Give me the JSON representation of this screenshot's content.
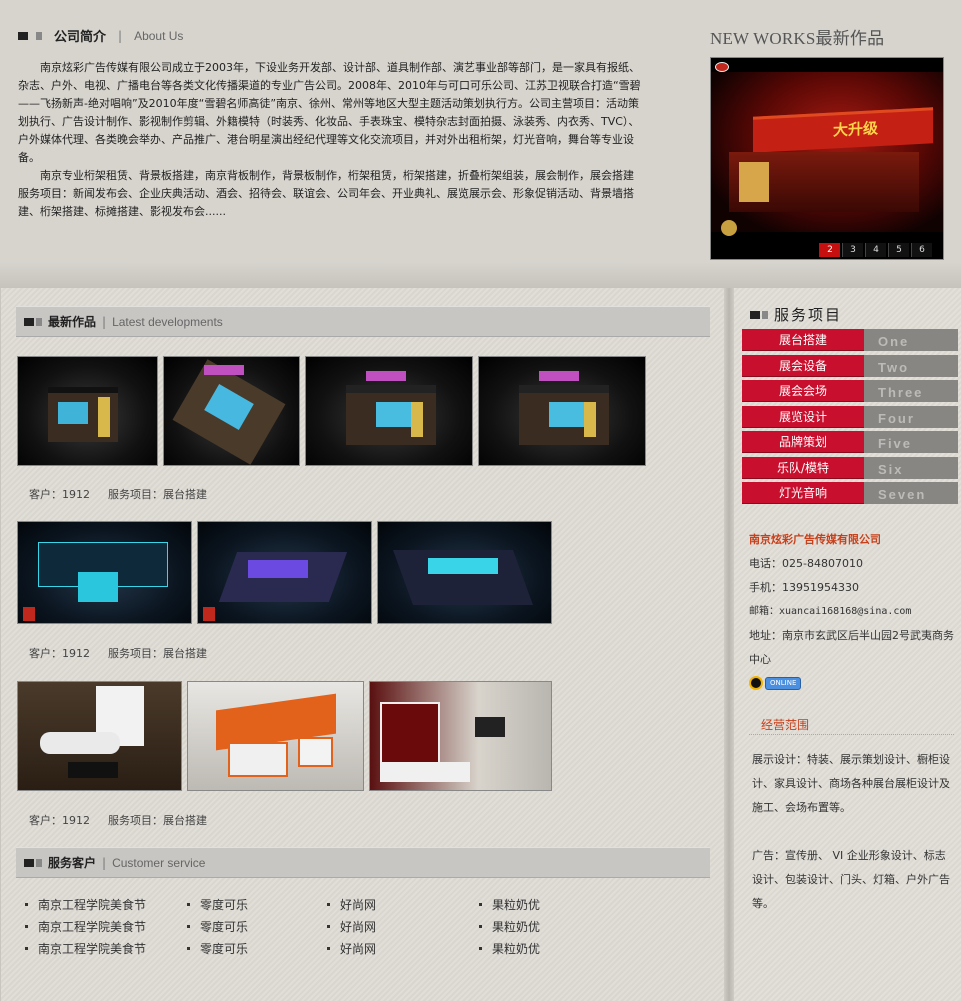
{
  "intro": {
    "title": "公司简介",
    "subtitle": "About Us",
    "paragraphs": [
      "南京炫彩广告传媒有限公司成立于2003年，下设业务开发部、设计部、道具制作部、演艺事业部等部门，是一家具有报纸、杂志、户外、电视、广播电台等各类文化传播渠道的专业广告公司。2008年、2010年与可口可乐公司、江苏卫视联合打造“雪碧——飞扬新声-绝对唱响”及2010年度“雪碧名师高徒”南京、徐州、常州等地区大型主题活动策划执行方。公司主营项目：活动策划执行、广告设计制作、影视制作剪辑、外籍模特（时装秀、化妆品、手表珠宝、模特杂志封面拍摄、泳装秀、内衣秀、TVC）、户外媒体代理、各类晚会举办、产品推广、港台明星演出经纪代理等文化交流项目，并对外出租桁架，灯光音响，舞台等专业设备。",
      "南京专业桁架租赁、背景板搭建，南京背板制作，背景板制作，桁架租赁，桁架搭建，折叠桁架组装，展会制作，展会搭建服务项目：新闻发布会、企业庆典活动、酒会、招待会、联谊会、公司年会、开业典礼、展览展示会、形象促销活动、背景墙搭建、桁架搭建、标摊搭建、影视发布会......"
    ]
  },
  "new_works": {
    "title": "NEW WORKS最新作品",
    "banner_text": "大升级",
    "pager": [
      "2",
      "3",
      "4",
      "5",
      "6"
    ],
    "active_page": "2"
  },
  "latest": {
    "title": "最新作品",
    "subtitle": "Latest developments",
    "groups": [
      {
        "client": "客户：1912",
        "service": "服务项目：展台搭建"
      },
      {
        "client": "客户：1912",
        "service": "服务项目：展台搭建"
      },
      {
        "client": "客户：1912",
        "service": "服务项目：展台搭建"
      }
    ]
  },
  "clients_section": {
    "title": "服务客户",
    "subtitle": "Customer service",
    "rows": [
      [
        "南京工程学院美食节",
        "零度可乐",
        "好尚网",
        "果粒奶优"
      ],
      [
        "南京工程学院美食节",
        "零度可乐",
        "好尚网",
        "果粒奶优"
      ],
      [
        "南京工程学院美食节",
        "零度可乐",
        "好尚网",
        "果粒奶优"
      ]
    ]
  },
  "services": {
    "title": "服务项目",
    "items": [
      {
        "label": "展台搭建",
        "num": "One"
      },
      {
        "label": "展会设备",
        "num": "Two"
      },
      {
        "label": "展会会场",
        "num": "Three"
      },
      {
        "label": "展览设计",
        "num": "Four"
      },
      {
        "label": "品牌策划",
        "num": "Five"
      },
      {
        "label": "乐队/模特",
        "num": "Six"
      },
      {
        "label": "灯光音响",
        "num": "Seven"
      }
    ]
  },
  "contact": {
    "company": "南京炫彩广告传媒有限公司",
    "phone": "电话：025-84807010",
    "mobile": "手机：13951954330",
    "email": "邮箱：xuancai168168@sina.com",
    "address": "地址：南京市玄武区后半山园2号武夷商务中心",
    "qq_badge": "ONLINE"
  },
  "scope": {
    "title": "经营范围",
    "text1": "展示设计：特装、展示策划设计、橱柜设计、家具设计、商场各种展台展柜设计及施工、会场布置等。",
    "text2": "广告：宣传册、 VI 企业形象设计、标志设计、包装设计、门头、灯箱、户外广告等。"
  },
  "colors": {
    "accent_red": "#c8102e",
    "service_gray": "#888683",
    "company_orange": "#c8401a"
  }
}
